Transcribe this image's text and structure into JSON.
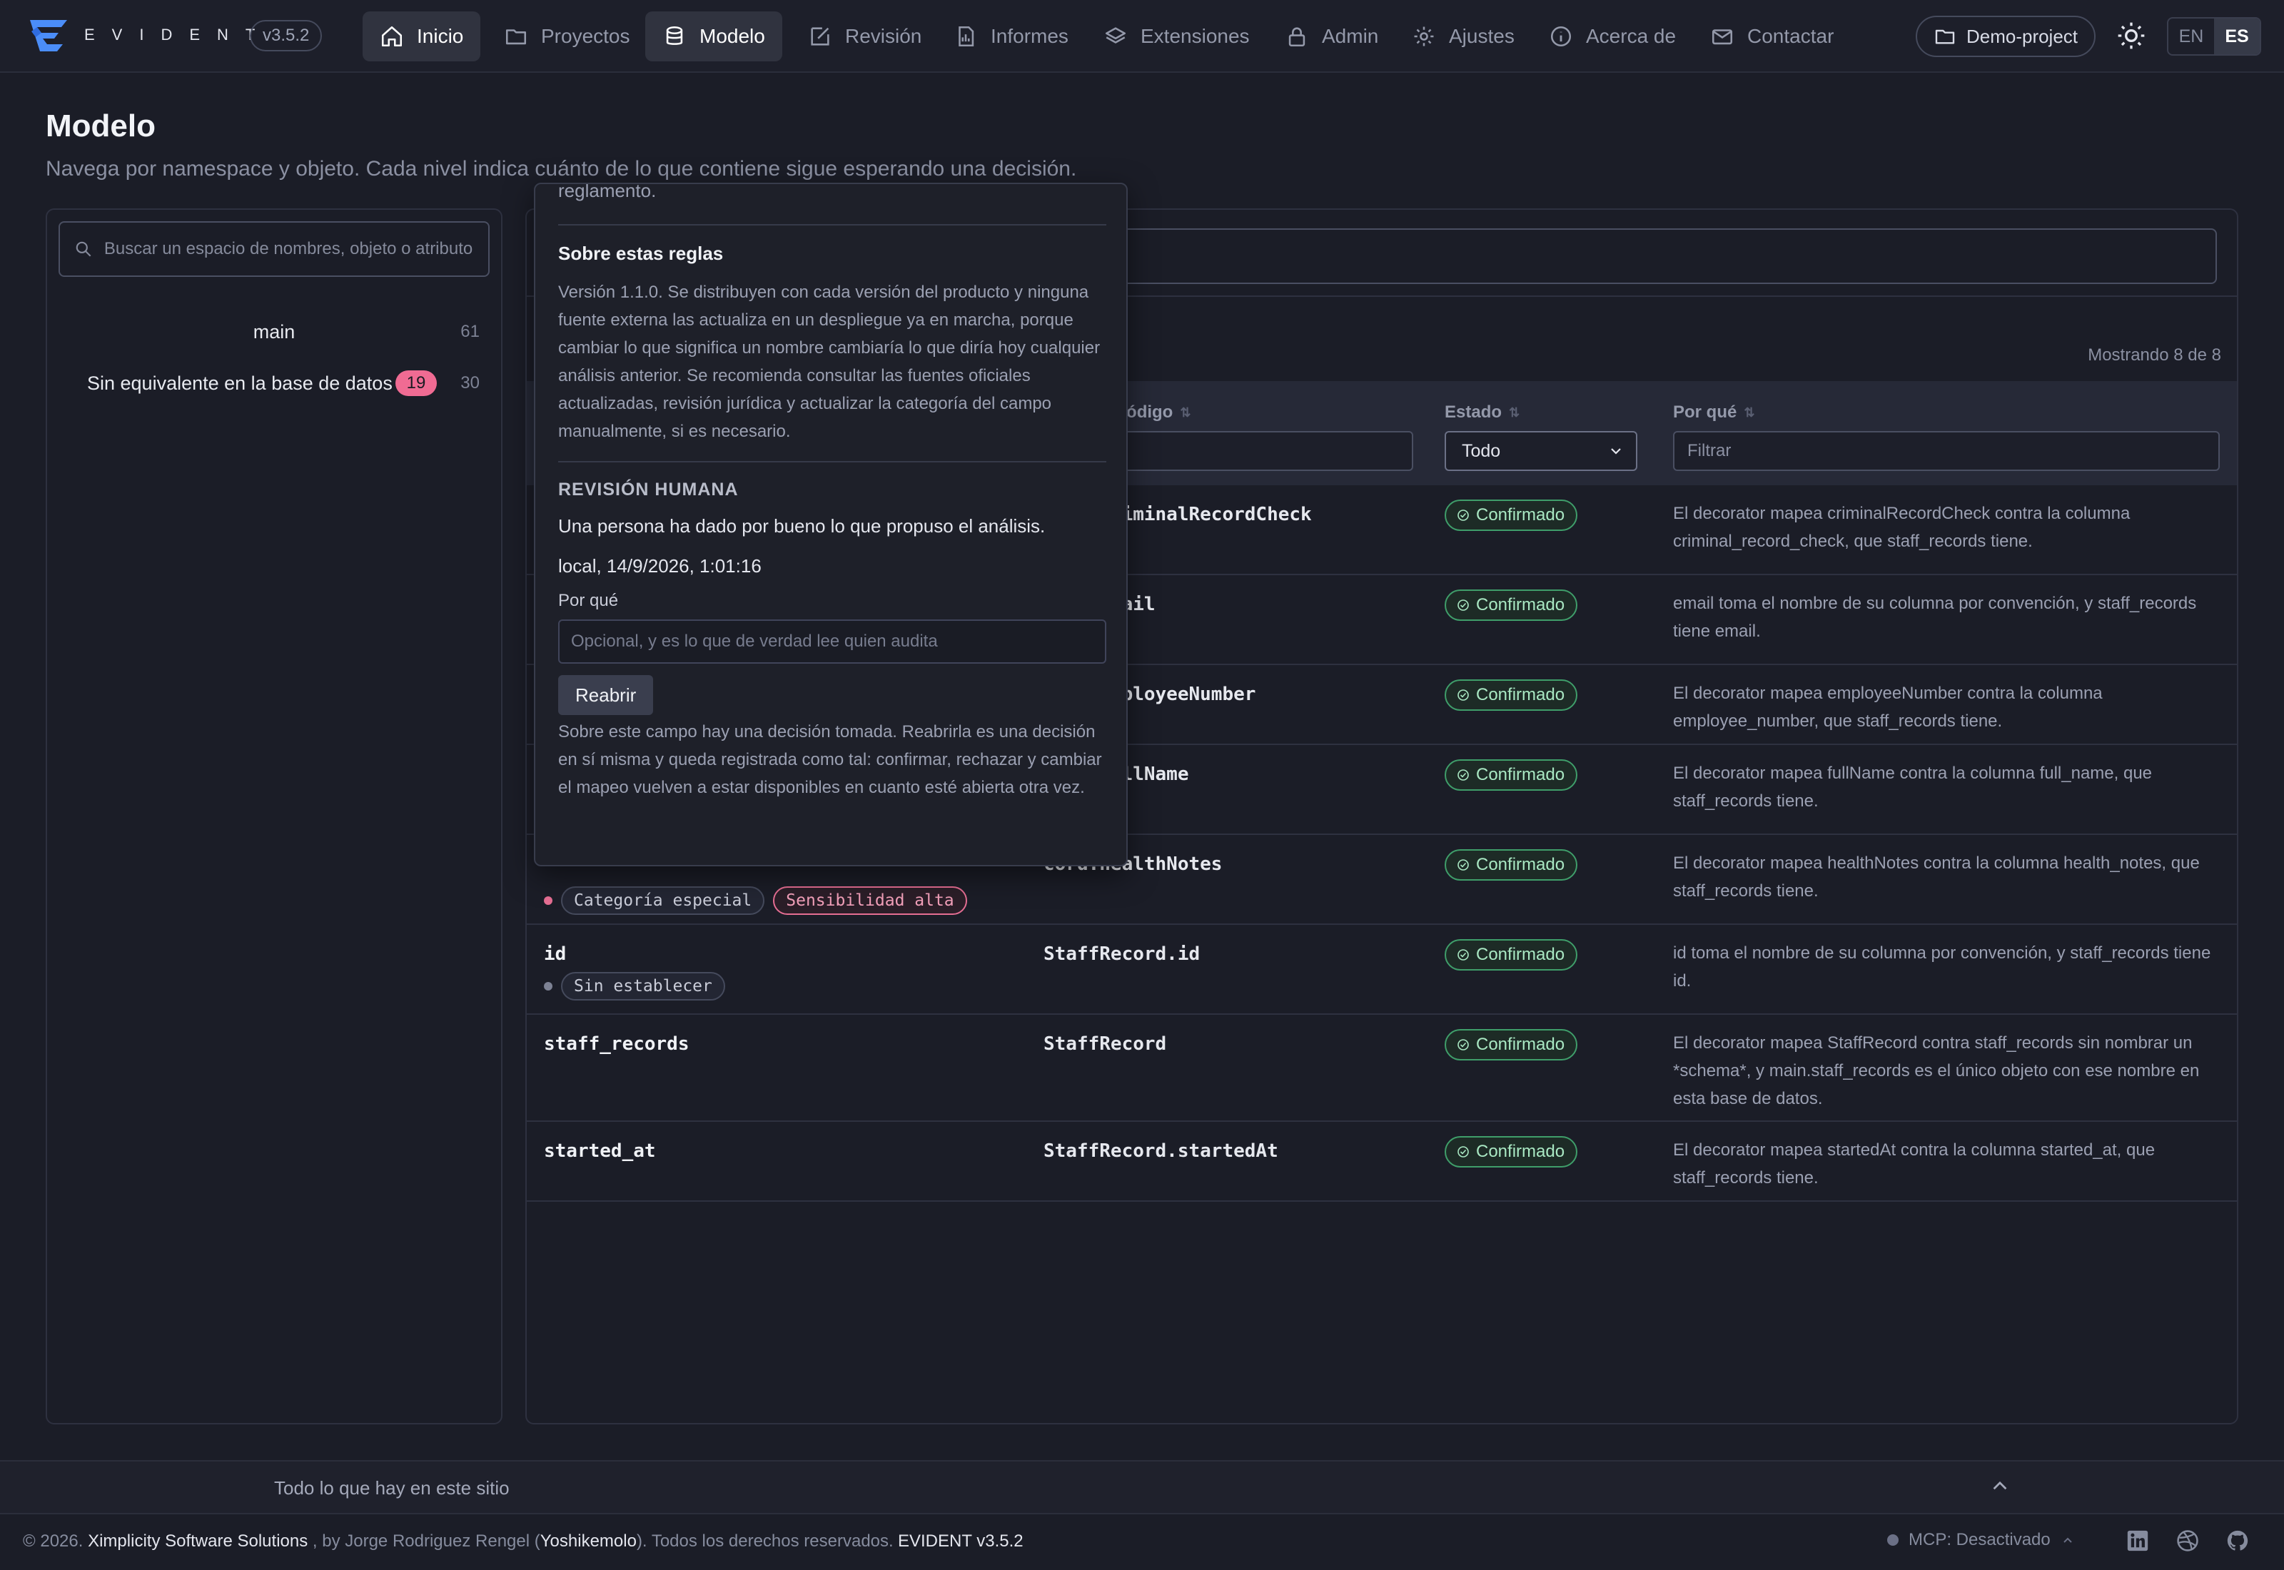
{
  "app": {
    "brand": "EVIDENT",
    "version": "v3.5.2",
    "accent": "#3b82f6"
  },
  "nav": {
    "items": [
      {
        "label": "Inicio",
        "icon": "home-icon"
      },
      {
        "label": "Proyectos",
        "icon": "folder-icon"
      },
      {
        "label": "Modelo",
        "icon": "database-icon"
      },
      {
        "label": "Revisión",
        "icon": "edit-icon"
      },
      {
        "label": "Informes",
        "icon": "report-icon"
      },
      {
        "label": "Extensiones",
        "icon": "layers-icon"
      },
      {
        "label": "Admin",
        "icon": "lock-icon"
      },
      {
        "label": "Ajustes",
        "icon": "gear-icon"
      },
      {
        "label": "Acerca de",
        "icon": "info-icon"
      },
      {
        "label": "Contactar",
        "icon": "mail-icon"
      }
    ],
    "project": "Demo-project",
    "lang_en": "EN",
    "lang_es": "ES"
  },
  "page": {
    "title": "Modelo",
    "subtitle": "Navega por namespace y objeto. Cada nivel indica cuánto de lo que contiene sigue esperando una decisión."
  },
  "sidebar": {
    "search_placeholder": "Buscar un espacio de nombres, objeto o atributo",
    "items": [
      {
        "label": "main",
        "count": "61"
      },
      {
        "label": "Sin equivalente en la base de datos",
        "badge": "19",
        "count": "30"
      }
    ]
  },
  "table": {
    "showing": "Mostrando 8 de 8",
    "headers": {
      "code": "le código",
      "status": "Estado",
      "why": "Por qué"
    },
    "status_filter": "Todo",
    "why_filter_placeholder": "Filtrar",
    "tags": {
      "special": "Categoría especial",
      "high": "Sensibilidad alta",
      "unset": "Sin establecer"
    },
    "rows": [
      {
        "field": "",
        "code": "cord.criminalRecordCheck",
        "status": "Confirmado",
        "why": "El decorator mapea criminalRecordCheck contra la columna criminal_record_check, que staff_records tiene."
      },
      {
        "field": "",
        "code": "cord.email",
        "status": "Confirmado",
        "why": "email toma el nombre de su columna por convención, y staff_records tiene email."
      },
      {
        "field": "",
        "code": "cord.employeeNumber",
        "status": "Confirmado",
        "why": "El decorator mapea employeeNumber contra la columna employee_number, que staff_records tiene."
      },
      {
        "field": "",
        "code": "cord.fullName",
        "status": "Confirmado",
        "why": "El decorator mapea fullName contra la columna full_name, que staff_records tiene."
      },
      {
        "field": "",
        "code": "cord.healthNotes",
        "status": "Confirmado",
        "why": "El decorator mapea healthNotes contra la columna health_notes, que staff_records tiene."
      },
      {
        "field": "id",
        "code": "StaffRecord.id",
        "status": "Confirmado",
        "why": "id toma el nombre de su columna por convención, y staff_records tiene id."
      },
      {
        "field": "staff_records",
        "code": "StaffRecord",
        "status": "Confirmado",
        "why": "El decorator mapea StaffRecord contra staff_records sin nombrar un *schema*, y main.staff_records es el único objeto con ese nombre en esta base de datos."
      },
      {
        "field": "started_at",
        "code": "StaffRecord.startedAt",
        "status": "Confirmado",
        "why": "El decorator mapea startedAt contra la columna started_at, que staff_records tiene."
      }
    ]
  },
  "popover": {
    "cut_text": "reglamento.",
    "rules_title": "Sobre estas reglas",
    "rules_text": "Versión 1.1.0. Se distribuyen con cada versión del producto y ninguna fuente externa las actualiza en un despliegue ya en marcha, porque cambiar lo que significa un nombre cambiaría lo que diría hoy cualquier análisis anterior. Se recomienda consultar las fuentes oficiales actualizadas, revisión jurídica y actualizar la categoría del campo manualmente, si es necesario.",
    "review_label": "REVISIÓN HUMANA",
    "review_text": "Una persona ha dado por bueno lo que propuso el análisis.",
    "review_meta": "local, 14/9/2026, 1:01:16",
    "why_label": "Por qué",
    "why_placeholder": "Opcional, y es lo que de verdad lee quien audita",
    "reopen": "Reabrir",
    "note": "Sobre este campo hay una decisión tomada. Reabrirla es una decisión en sí misma y queda registrada como tal: confirmar, rechazar y cambiar el mapeo vuelven a estar disponibles en cuanto esté abierta otra vez."
  },
  "bottom": {
    "disclosure": "Todo lo que hay en este sitio"
  },
  "footer": {
    "copy": "© 2026.",
    "company": "Ximplicity Software Solutions",
    "by": ", by Jorge Rodriguez Rengel (",
    "handle": "Yoshikemolo",
    "rights": "). Todos los derechos reservados.",
    "version": "EVIDENT v3.5.2",
    "mcp": "MCP: Desactivado"
  }
}
